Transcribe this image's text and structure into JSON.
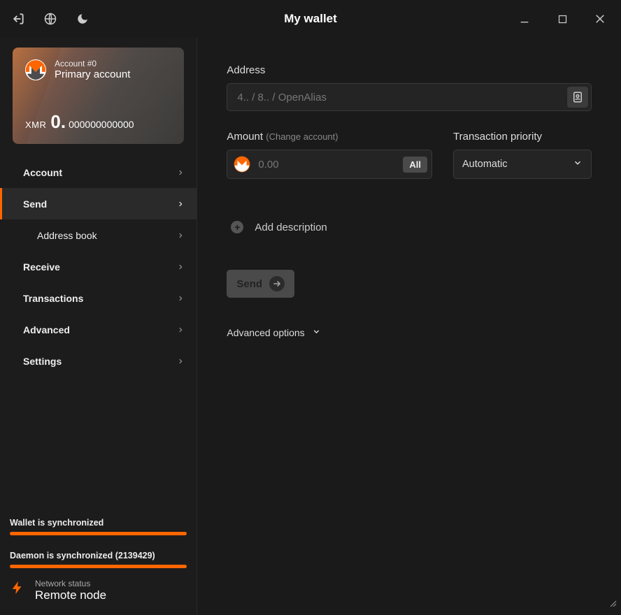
{
  "titlebar": {
    "title": "My wallet"
  },
  "account": {
    "number": "Account #0",
    "name": "Primary account",
    "ticker": "XMR",
    "balance_int": "0.",
    "balance_frac": "000000000000"
  },
  "nav": {
    "account": "Account",
    "send": "Send",
    "address_book": "Address book",
    "receive": "Receive",
    "transactions": "Transactions",
    "advanced": "Advanced",
    "settings": "Settings"
  },
  "sync": {
    "wallet": "Wallet is synchronized",
    "daemon": "Daemon is synchronized (2139429)"
  },
  "network": {
    "label": "Network status",
    "value": "Remote node"
  },
  "send_form": {
    "address_label": "Address",
    "address_placeholder": "4.. / 8.. / OpenAlias",
    "amount_label": "Amount",
    "amount_sublabel": "(Change account)",
    "amount_placeholder": "0.00",
    "all_btn": "All",
    "priority_label": "Transaction priority",
    "priority_value": "Automatic",
    "add_description": "Add description",
    "send_btn": "Send",
    "advanced_options": "Advanced options"
  }
}
